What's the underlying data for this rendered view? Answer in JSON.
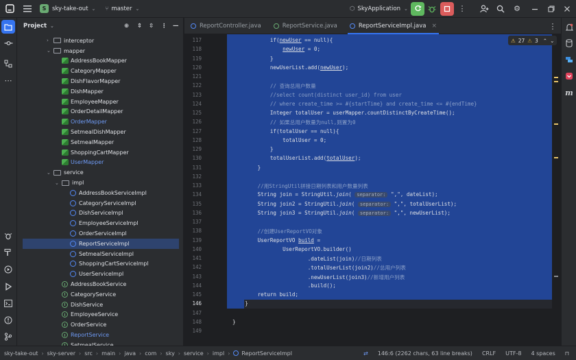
{
  "titlebar": {
    "project_badge": "S",
    "project_name": "sky-take-out",
    "branch": "master",
    "run_config": "SkyApplication"
  },
  "project_panel": {
    "title": "Project",
    "tree": [
      {
        "label": "interceptor",
        "kind": "folder",
        "expand": "collapsed",
        "indent": 1
      },
      {
        "label": "mapper",
        "kind": "folder",
        "expand": "expanded",
        "indent": 1
      },
      {
        "label": "AddressBookMapper",
        "kind": "mapper",
        "indent": 2
      },
      {
        "label": "CategoryMapper",
        "kind": "mapper",
        "indent": 2
      },
      {
        "label": "DishFlavorMapper",
        "kind": "mapper",
        "indent": 2
      },
      {
        "label": "DishMapper",
        "kind": "mapper",
        "indent": 2
      },
      {
        "label": "EmployeeMapper",
        "kind": "mapper",
        "indent": 2
      },
      {
        "label": "OrderDetailMapper",
        "kind": "mapper",
        "indent": 2
      },
      {
        "label": "OrderMapper",
        "kind": "mapper",
        "indent": 2,
        "modified": true
      },
      {
        "label": "SetmealDishMapper",
        "kind": "mapper",
        "indent": 2
      },
      {
        "label": "SetmealMapper",
        "kind": "mapper",
        "indent": 2
      },
      {
        "label": "ShoppingCartMapper",
        "kind": "mapper",
        "indent": 2
      },
      {
        "label": "UserMapper",
        "kind": "mapper",
        "indent": 2,
        "modified": true
      },
      {
        "label": "service",
        "kind": "folder",
        "expand": "expanded",
        "indent": 1
      },
      {
        "label": "impl",
        "kind": "folder",
        "expand": "expanded",
        "indent": 2
      },
      {
        "label": "AddressBookServiceImpl",
        "kind": "class",
        "indent": 3
      },
      {
        "label": "CategoryServiceImpl",
        "kind": "class",
        "indent": 3
      },
      {
        "label": "DishServiceImpl",
        "kind": "class",
        "indent": 3
      },
      {
        "label": "EmployeeServiceImpl",
        "kind": "class",
        "indent": 3
      },
      {
        "label": "OrderServiceImpl",
        "kind": "class",
        "indent": 3
      },
      {
        "label": "ReportServiceImpl",
        "kind": "class",
        "indent": 3,
        "selected": true
      },
      {
        "label": "SetmealServiceImpl",
        "kind": "class",
        "indent": 3
      },
      {
        "label": "ShoppingCartServiceImpl",
        "kind": "class",
        "indent": 3
      },
      {
        "label": "UserServiceImpl",
        "kind": "class",
        "indent": 3
      },
      {
        "label": "AddressBookService",
        "kind": "interface",
        "indent": 2
      },
      {
        "label": "CategoryService",
        "kind": "interface",
        "indent": 2
      },
      {
        "label": "DishService",
        "kind": "interface",
        "indent": 2
      },
      {
        "label": "EmployeeService",
        "kind": "interface",
        "indent": 2
      },
      {
        "label": "OrderService",
        "kind": "interface",
        "indent": 2
      },
      {
        "label": "ReportService",
        "kind": "interface",
        "indent": 2,
        "modified": true
      },
      {
        "label": "SetmealService",
        "kind": "interface",
        "indent": 2
      }
    ]
  },
  "tabs": [
    {
      "label": "ReportController.java",
      "icon": "class-icon"
    },
    {
      "label": "ReportService.java",
      "icon": "interface-icon"
    },
    {
      "label": "ReportServiceImpl.java",
      "icon": "class-icon",
      "active": true
    }
  ],
  "inspections": {
    "warnings": "27",
    "weak_warnings": "3"
  },
  "code_lines": [
    {
      "n": "117",
      "html": "            if(<u>newUser</u> == null){"
    },
    {
      "n": "118",
      "html": "                <u>newUser</u> = 0;"
    },
    {
      "n": "119",
      "html": "            }"
    },
    {
      "n": "120",
      "html": "            newUserList.add(<u>newUser</u>);"
    },
    {
      "n": "121",
      "html": ""
    },
    {
      "n": "122",
      "html": "            <span class=\"cm\">// 查询总用户数量</span>"
    },
    {
      "n": "123",
      "html": "            <span class=\"cm\">//select count(distinct user_id) from user</span>"
    },
    {
      "n": "124",
      "html": "            <span class=\"cm\">// where create_time >= #{startTime} and create_time <= #{endTime}</span>"
    },
    {
      "n": "125",
      "html": "            Integer totalUser = userMapper.countDistinctByCreateTime();"
    },
    {
      "n": "126",
      "html": "            <span class=\"cm\">// 如果总用户数量为null,则置为0</span>"
    },
    {
      "n": "127",
      "html": "            if(totalUser == null){"
    },
    {
      "n": "128",
      "html": "                totalUser = 0;"
    },
    {
      "n": "129",
      "html": "            }"
    },
    {
      "n": "130",
      "html": "            totalUserList.add(<u>totalUser</u>);"
    },
    {
      "n": "131",
      "html": "        }"
    },
    {
      "n": "132",
      "html": ""
    },
    {
      "n": "133",
      "html": "        <span class=\"cm\">//用StringUtil拼接日期列表和用户数量列表</span>"
    },
    {
      "n": "134",
      "html": "        String join = StringUtil.<i>join</i>( <span class=\"hint\">separator:</span> \",\", dateList);"
    },
    {
      "n": "135",
      "html": "        String join2 = StringUtil.<i>join</i>( <span class=\"hint\">separator:</span> \",\", totalUserList);"
    },
    {
      "n": "136",
      "html": "        String join3 = StringUtil.<i>join</i>( <span class=\"hint\">separator:</span> \",\", newUserList);"
    },
    {
      "n": "137",
      "html": ""
    },
    {
      "n": "138",
      "html": "        <span class=\"cm\">//创建UserReportVO对象</span>"
    },
    {
      "n": "139",
      "html": "        UserReportVO <u>build</u> ="
    },
    {
      "n": "140",
      "html": "                UserReportVO.builder()"
    },
    {
      "n": "141",
      "html": "                        .dateList(join)<span class=\"cm\">//日期列表</span>"
    },
    {
      "n": "142",
      "html": "                        .totalUserList(join2)<span class=\"cm\">//总用户列表</span>"
    },
    {
      "n": "143",
      "html": "                        .newUserList(join3)<span class=\"cm\">//新增用户列表</span>"
    },
    {
      "n": "144",
      "html": "                        .build();"
    },
    {
      "n": "145",
      "html": "        return build;"
    },
    {
      "n": "146",
      "html": "    }",
      "current": true
    },
    {
      "n": "147",
      "html": ""
    },
    {
      "n": "148",
      "html": "}"
    },
    {
      "n": "149",
      "html": ""
    }
  ],
  "breadcrumb": [
    "sky-take-out",
    "sky-server",
    "src",
    "main",
    "java",
    "com",
    "sky",
    "service",
    "impl",
    "ReportServiceImpl"
  ],
  "status": {
    "position": "146:6 (2262 chars, 63 line breaks)",
    "line_sep": "CRLF",
    "encoding": "UTF-8",
    "indent": "4 spaces"
  },
  "colors": {
    "selection": "#224596",
    "accent": "#3574f0",
    "run": "#5fb85f",
    "stop": "#db5c5c"
  }
}
